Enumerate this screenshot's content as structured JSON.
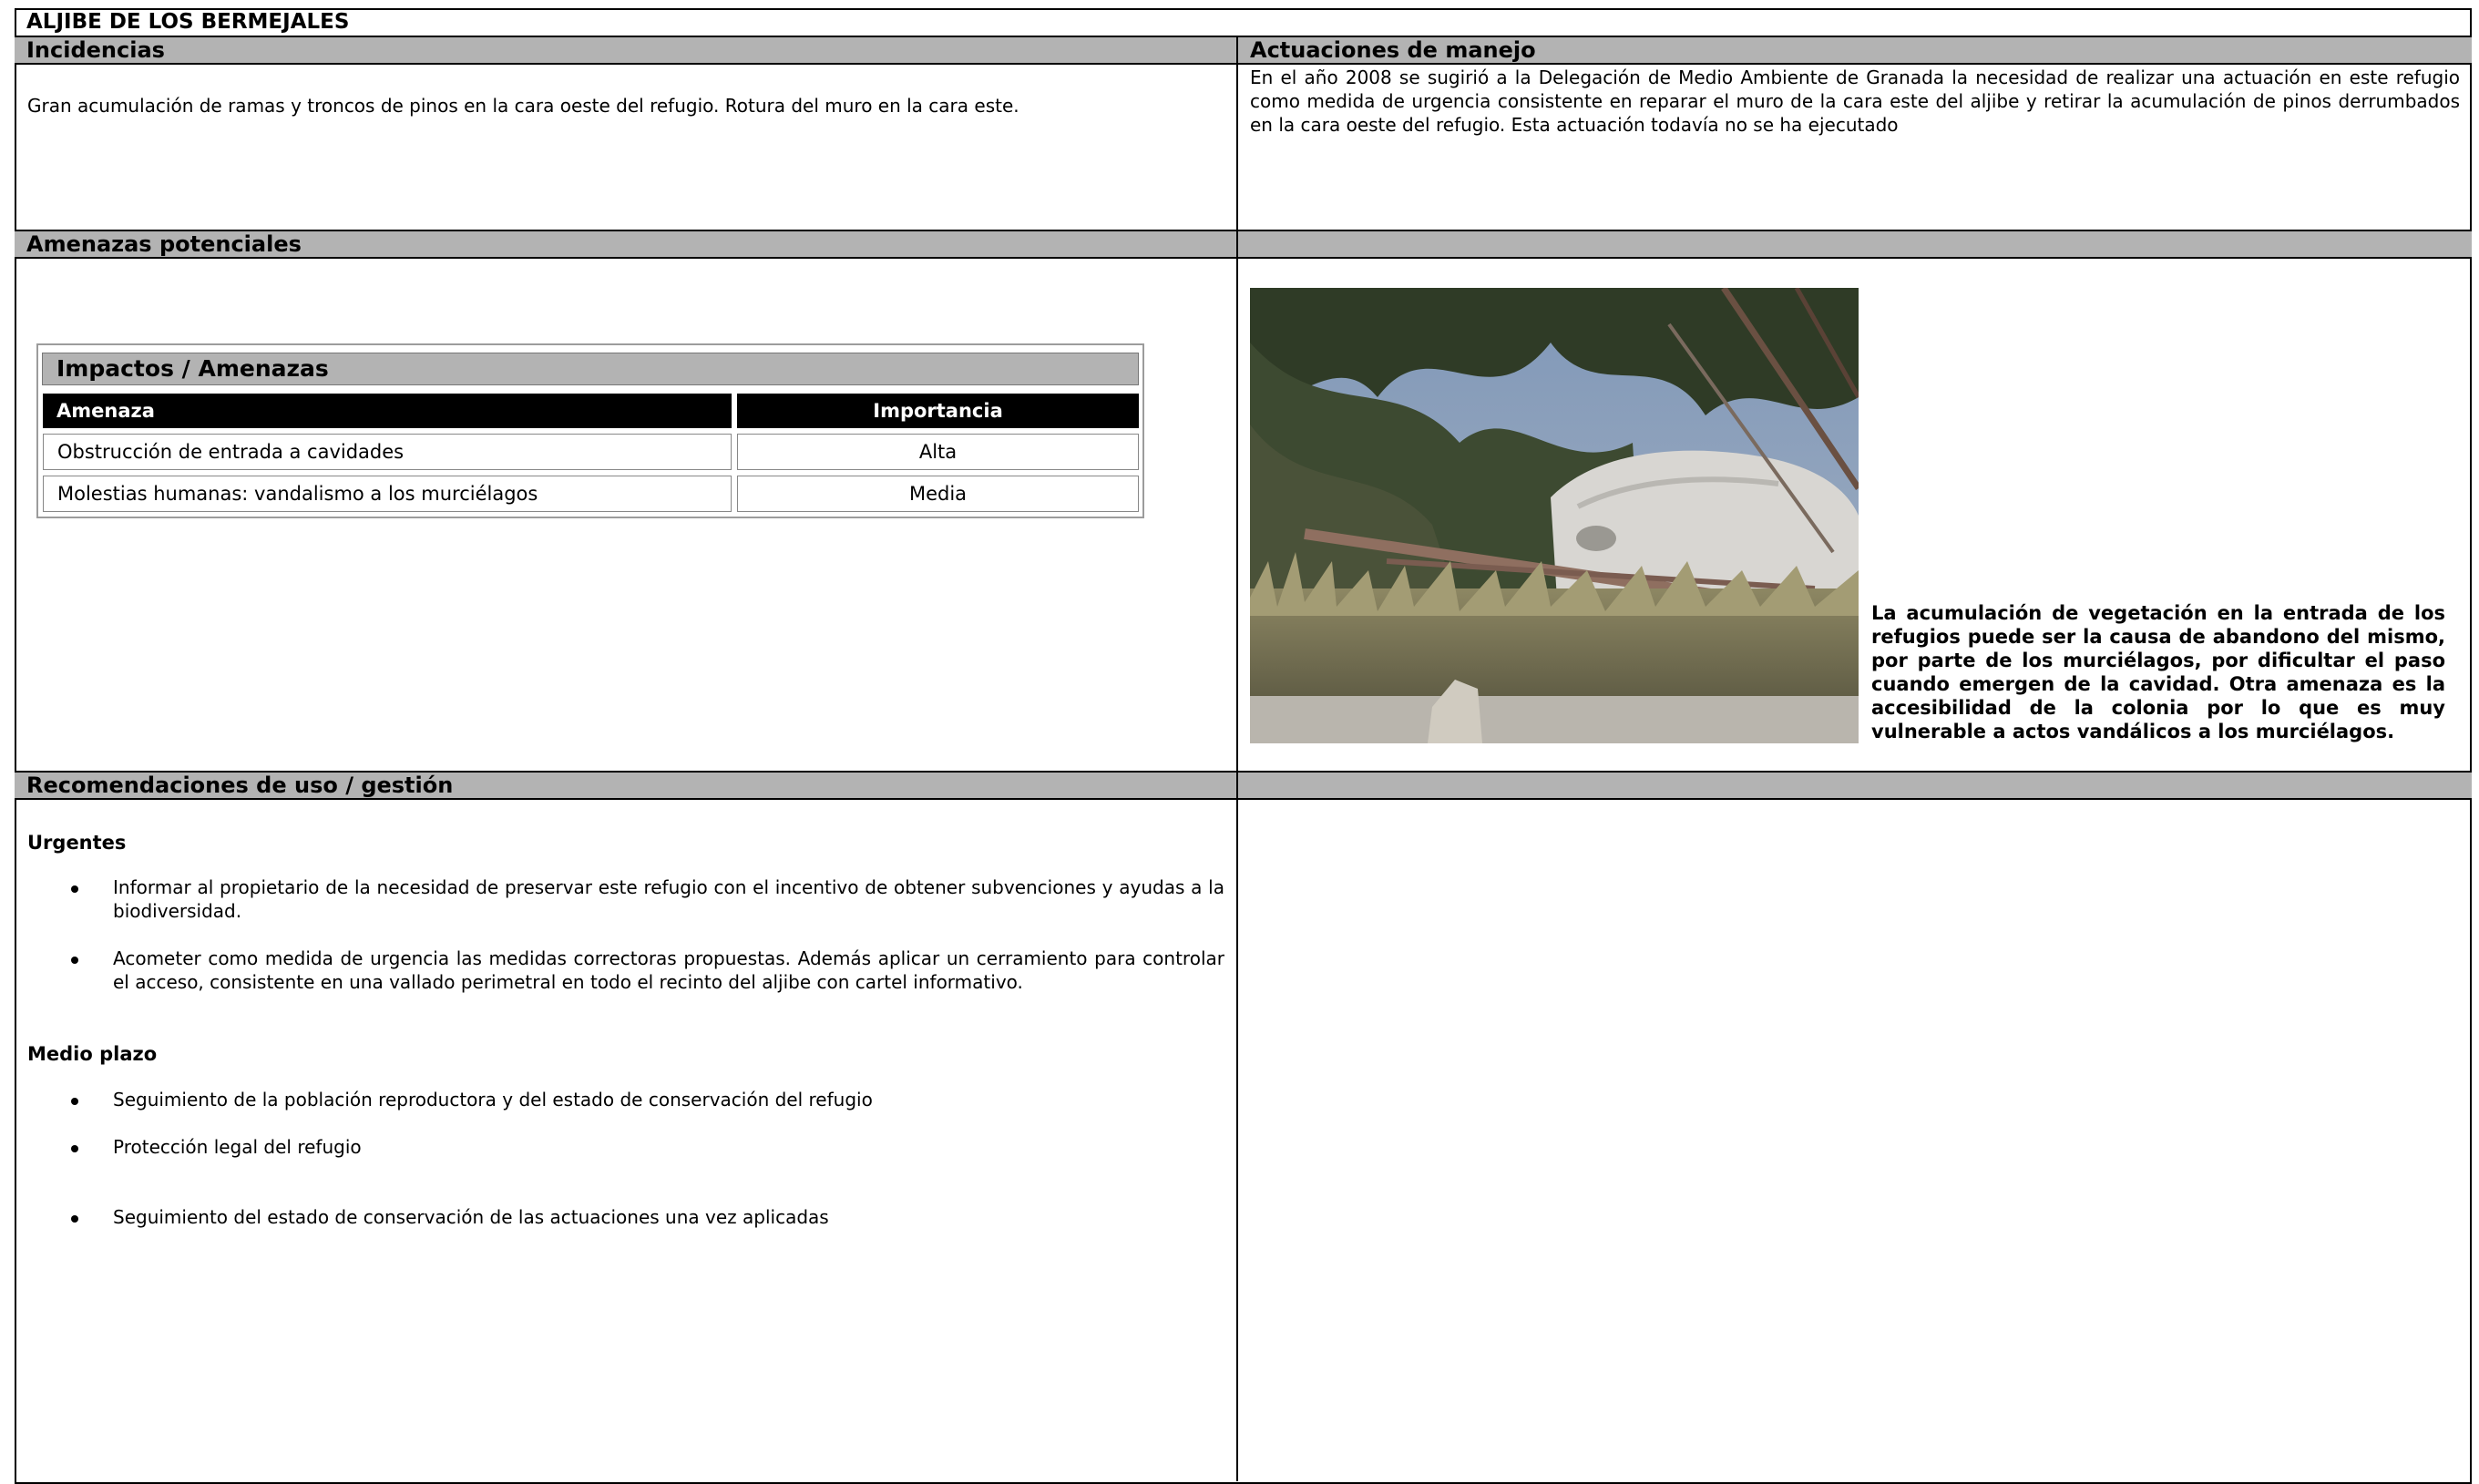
{
  "title": "ALJIBE DE LOS BERMEJALES",
  "sections": {
    "incidencias": {
      "heading": "Incidencias",
      "text": "Gran acumulación de ramas y troncos de pinos en la cara oeste del refugio. Rotura del muro en la cara este."
    },
    "actuaciones": {
      "heading": "Actuaciones de manejo",
      "text": "En el año 2008 se sugirió a la Delegación de Medio Ambiente de Granada la necesidad de realizar una actuación en este refugio como medida de urgencia consistente en reparar el muro de la cara este del aljibe y retirar la acumulación de pinos derrumbados en la cara oeste del refugio. Esta actuación todavía no se ha ejecutado"
    },
    "amenazas": {
      "heading": "Amenazas potenciales",
      "table": {
        "title": "Impactos / Amenazas",
        "col_amenaza": "Amenaza",
        "col_importancia": "Importancia",
        "rows": [
          {
            "amenaza": "Obstrucción de entrada a cavidades",
            "importancia": "Alta"
          },
          {
            "amenaza": "Molestias humanas: vandalismo a los murciélagos",
            "importancia": "Media"
          }
        ]
      },
      "photo_caption": "La acumulación de vegetación en la entrada de los refugios puede ser la causa de abandono del mismo, por parte de los murciélagos, por dificultar el paso cuando emergen de la cavidad. Otra amenaza es la accesibilidad de la colonia por lo que es muy vulnerable a actos vandálicos a los murciélagos."
    },
    "recomendaciones": {
      "heading": "Recomendaciones de uso / gestión",
      "urgentes_label": "Urgentes",
      "urgentes": [
        "Informar al propietario de la necesidad de preservar este refugio con el incentivo de obtener subvenciones y ayudas a la biodiversidad.",
        "Acometer como medida de urgencia las medidas correctoras propuestas. Además aplicar un cerramiento para controlar el acceso, consistente en una vallado perimetral en todo el recinto del aljibe con cartel informativo."
      ],
      "medio_label": "Medio plazo",
      "medio": [
        "Seguimiento de la población reproductora y del estado de conservación del refugio",
        "Protección legal del refugio",
        "Seguimiento del estado de conservación de las actuaciones una vez aplicadas"
      ]
    }
  }
}
